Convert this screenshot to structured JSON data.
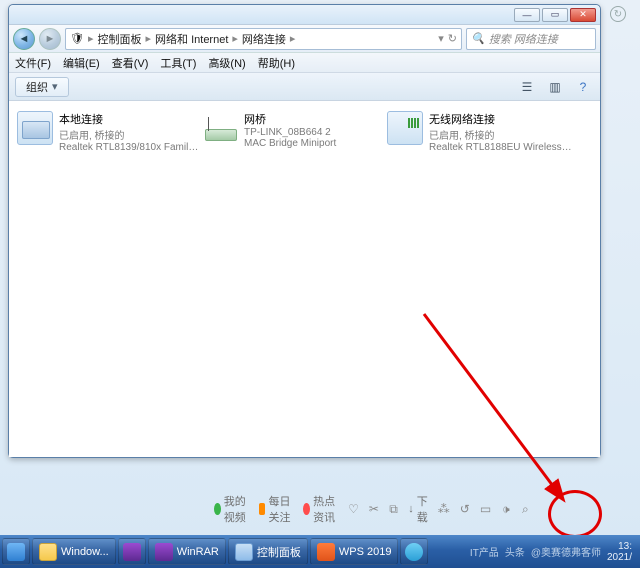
{
  "window": {
    "breadcrumb": {
      "root_icon": "shield-folder",
      "seg1": "控制面板",
      "seg2": "网络和 Internet",
      "seg3": "网络连接"
    },
    "search_placeholder": "搜索 网络连接",
    "menus": {
      "file": "文件(F)",
      "edit": "编辑(E)",
      "view": "查看(V)",
      "tools": "工具(T)",
      "advanced": "高级(N)",
      "help": "帮助(H)"
    },
    "toolbar": {
      "organize": "组织"
    }
  },
  "connections": [
    {
      "title": "本地连接",
      "status": "已启用, 桥接的",
      "detail": "Realtek RTL8139/810x Family F..."
    },
    {
      "title": "网桥",
      "status": "TP-LINK_08B664  2",
      "detail": "MAC Bridge Miniport"
    },
    {
      "title": "无线网络连接",
      "status": "已启用, 桥接的",
      "detail": "Realtek RTL8188EU Wireless L..."
    }
  ],
  "status_strip": {
    "item_video": "我的视频",
    "item_daily": "每日关注",
    "item_hot": "热点资讯",
    "item_dl": "下载"
  },
  "taskbar": {
    "items": [
      {
        "label": ""
      },
      {
        "label": "Window..."
      },
      {
        "label": ""
      },
      {
        "label": "WinRAR"
      },
      {
        "label": "控制面板"
      },
      {
        "label": "WPS 2019"
      },
      {
        "label": ""
      }
    ],
    "tray_text1": "IT产品",
    "tray_text2": "头条",
    "tray_text3": "@奥赛德弗客师",
    "time": "13:",
    "date": "2021/"
  }
}
